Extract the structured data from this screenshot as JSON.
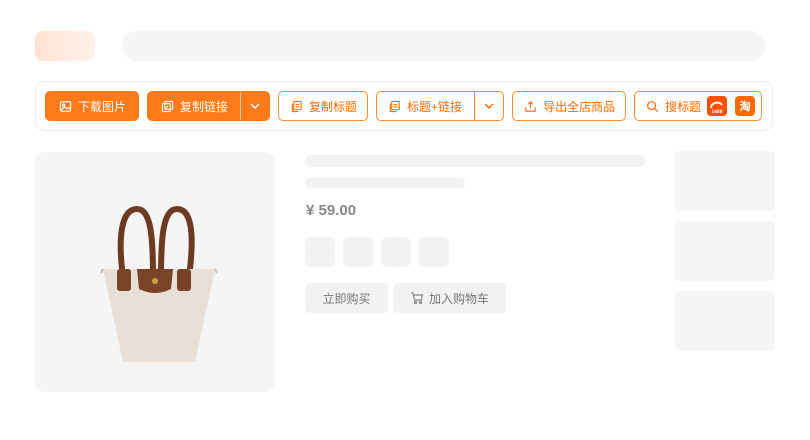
{
  "toolbar": {
    "download_images": "下载图片",
    "copy_link": "复制链接",
    "copy_title": "复制标题",
    "title_plus_link": "标题+链接",
    "export_store_products": "导出全店商品",
    "search_title": "搜标题",
    "site_1688_label": "1688",
    "site_taobao_label": "淘"
  },
  "product": {
    "price": "¥ 59.00",
    "buy_now": "立即购买",
    "add_to_cart": "加入购物车"
  },
  "colors": {
    "accent": "#ff7a1a",
    "accent_border": "#ff8a3d",
    "skeleton": "#f2f2f2"
  },
  "icons": [
    "image-icon",
    "copy-link-icon",
    "chevron-down-icon",
    "copy-icon",
    "export-icon",
    "search-icon",
    "cart-icon"
  ]
}
